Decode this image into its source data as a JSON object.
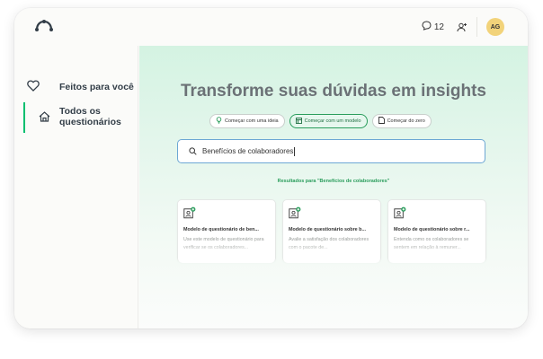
{
  "topbar": {
    "logo_icon": "surveymonkey-logo-icon",
    "comment_count": "12",
    "avatar_initials": "AG",
    "colors": {
      "avatar": "#f2d37a",
      "accent": "#00bf6f"
    }
  },
  "sidebar": {
    "items": [
      {
        "label": "Feitos para você",
        "icon": "heart-icon",
        "active": false
      },
      {
        "label": "Todos os questionários",
        "icon": "home-icon",
        "active": true
      }
    ]
  },
  "main": {
    "headline": "Transforme suas dúvidas em insights",
    "pills": [
      {
        "label": "Começar com uma ideia",
        "icon": "lightbulb-icon",
        "active": false
      },
      {
        "label": "Começar com um modelo",
        "icon": "template-icon",
        "active": true
      },
      {
        "label": "Começar do zero",
        "icon": "document-icon",
        "active": false
      }
    ],
    "search": {
      "value": "Benefícios de colaboradores",
      "icon": "search-icon"
    },
    "results_label": "Resultados para \"Benefícios de colaboradores\"",
    "cards": [
      {
        "title": "Modelo de questionário de ben...",
        "desc": "Use este modelo de questionário para verificar se os colaboradores..."
      },
      {
        "title": "Modelo de questionário sobre b...",
        "desc": "Avalie a satisfação dos colaboradores com o pacote de..."
      },
      {
        "title": "Modelo de questionário sobre r...",
        "desc": "Entenda como os colaboradores se sentem em relação à remuner..."
      }
    ]
  }
}
